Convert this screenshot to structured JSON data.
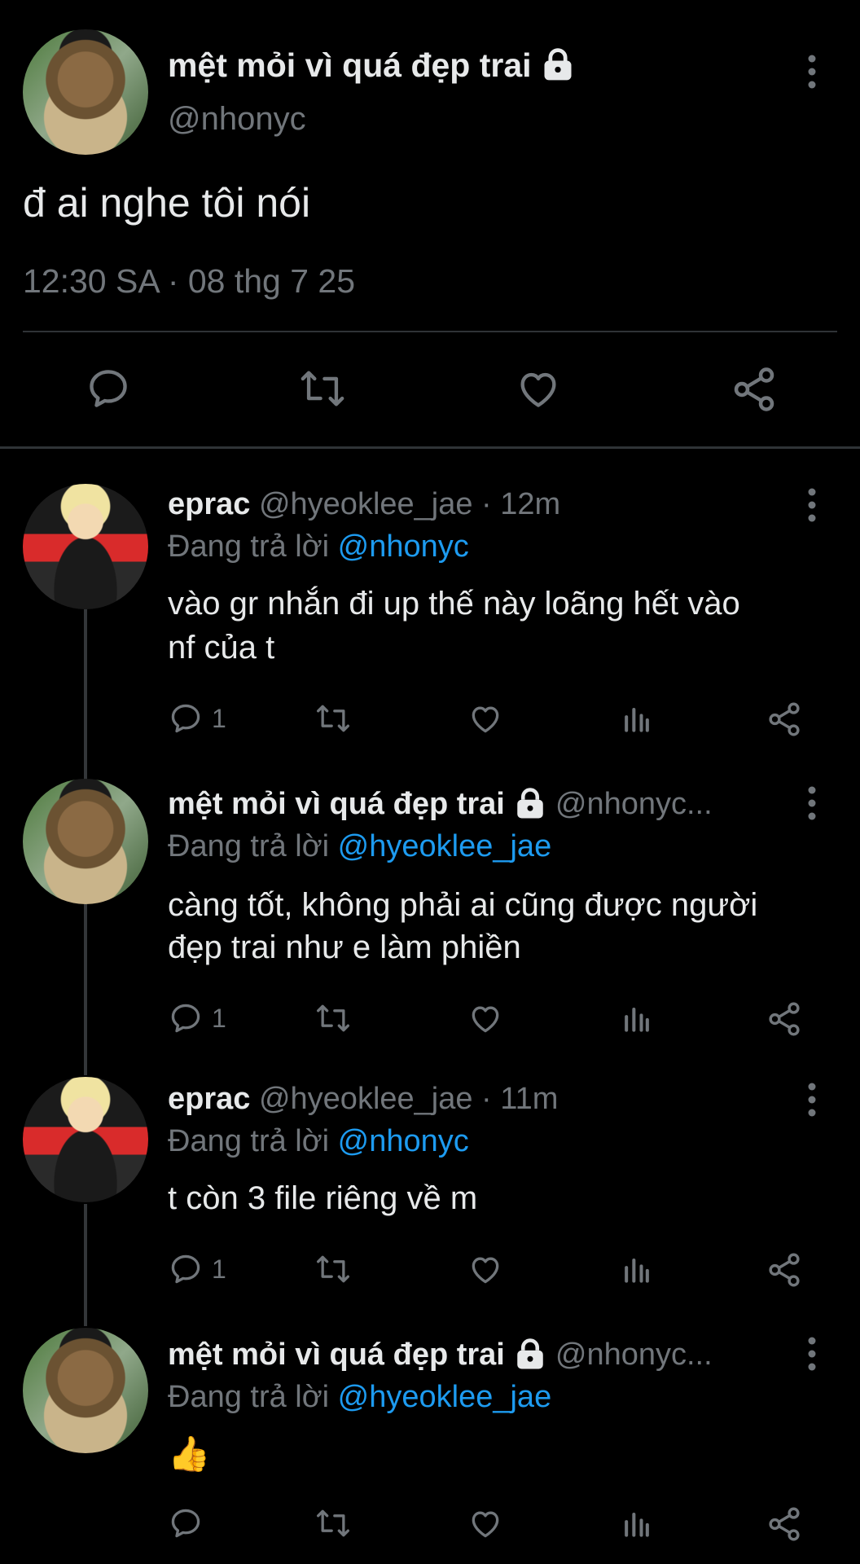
{
  "main_tweet": {
    "display_name": "mệt mỏi vì quá đẹp trai",
    "handle": "@nhonyc",
    "text": "đ ai nghe tôi nói",
    "timestamp": "12:30 SA · 08 thg 7 25"
  },
  "replies": [
    {
      "display_name": "eprac",
      "handle_time": "@hyeoklee_jae · 12m",
      "replying_label": "Đang trả lời",
      "replying_to": "@nhonyc",
      "text_line1": "vào gr nhắn đi up thế này loãng hết vào",
      "text_line2": "nf của t",
      "reply_count": "1"
    },
    {
      "display_name": "mệt mỏi vì quá đẹp trai",
      "handle_time": "@nhonyc...",
      "replying_label": "Đang trả lời",
      "replying_to": "@hyeoklee_jae",
      "text_line1": "càng tốt, không phải ai cũng được người",
      "text_line2": "đẹp trai như e làm phiền",
      "reply_count": "1"
    },
    {
      "display_name": "eprac",
      "handle_time": "@hyeoklee_jae · 11m",
      "replying_label": "Đang trả lời",
      "replying_to": "@nhonyc",
      "text_line1": "t còn 3 file riêng về m",
      "text_line2": "",
      "reply_count": "1"
    },
    {
      "display_name": "mệt mỏi vì quá đẹp trai",
      "handle_time": "@nhonyc...",
      "replying_label": "Đang trả lời",
      "replying_to": "@hyeoklee_jae",
      "text_line1": "👍",
      "text_line2": "",
      "reply_count": ""
    }
  ],
  "colors": {
    "background": "#000000",
    "text": "#e7e9ea",
    "muted": "#71767b",
    "link": "#1d9bf0",
    "divider": "#2f3336"
  },
  "icons": [
    "lock-icon",
    "more-icon",
    "reply-icon",
    "retweet-icon",
    "like-icon",
    "share-icon",
    "views-icon"
  ]
}
